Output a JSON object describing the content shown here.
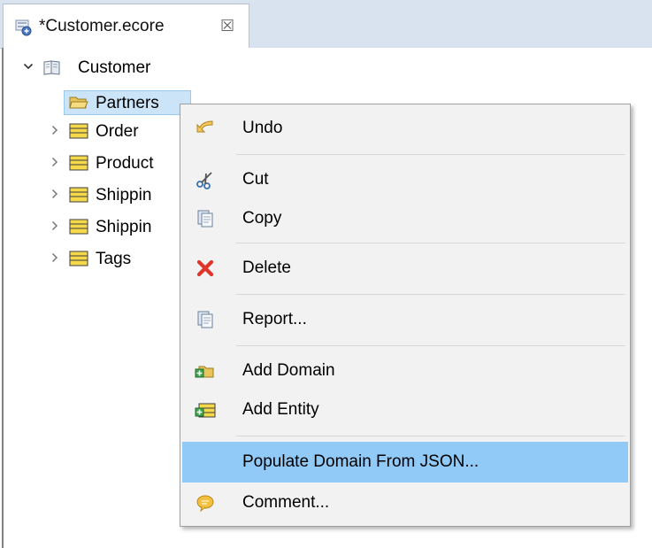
{
  "tab": {
    "title": "*Customer.ecore",
    "close_glyph": "☒",
    "icon": "ecore-model-icon"
  },
  "tree": {
    "root": {
      "label": "Customer",
      "expanded": true,
      "icon": "package-icon"
    },
    "children": [
      {
        "label": "Partners",
        "icon": "folder-open-icon",
        "expandable": false,
        "selected": true
      },
      {
        "label": "Order",
        "icon": "entity-icon",
        "expandable": true
      },
      {
        "label": "Product",
        "icon": "entity-icon",
        "expandable": true
      },
      {
        "label": "Shippin",
        "icon": "entity-icon",
        "expandable": true
      },
      {
        "label": "Shippin",
        "icon": "entity-icon",
        "expandable": true
      },
      {
        "label": "Tags",
        "icon": "entity-icon",
        "expandable": true
      }
    ]
  },
  "context_menu": {
    "items": [
      {
        "label": "Undo",
        "icon": "undo-icon"
      },
      {
        "label": "Cut",
        "icon": "scissors-icon"
      },
      {
        "label": "Copy",
        "icon": "copy-icon"
      },
      {
        "label": "Delete",
        "icon": "delete-icon"
      },
      {
        "label": "Report...",
        "icon": "report-icon"
      },
      {
        "label": "Add Domain",
        "icon": "add-domain-icon"
      },
      {
        "label": "Add Entity",
        "icon": "add-entity-icon"
      },
      {
        "label": "Populate Domain From JSON...",
        "highlighted": true
      },
      {
        "label": "Comment...",
        "icon": "comment-icon"
      }
    ]
  },
  "colors": {
    "tab_bar": "#d9e3f0",
    "selection": "#cce4f7",
    "menu_background": "#f2f2f2",
    "menu_highlight": "#91c9f7",
    "delete_red": "#e0352b",
    "entity_yellow": "#f5d94a"
  }
}
